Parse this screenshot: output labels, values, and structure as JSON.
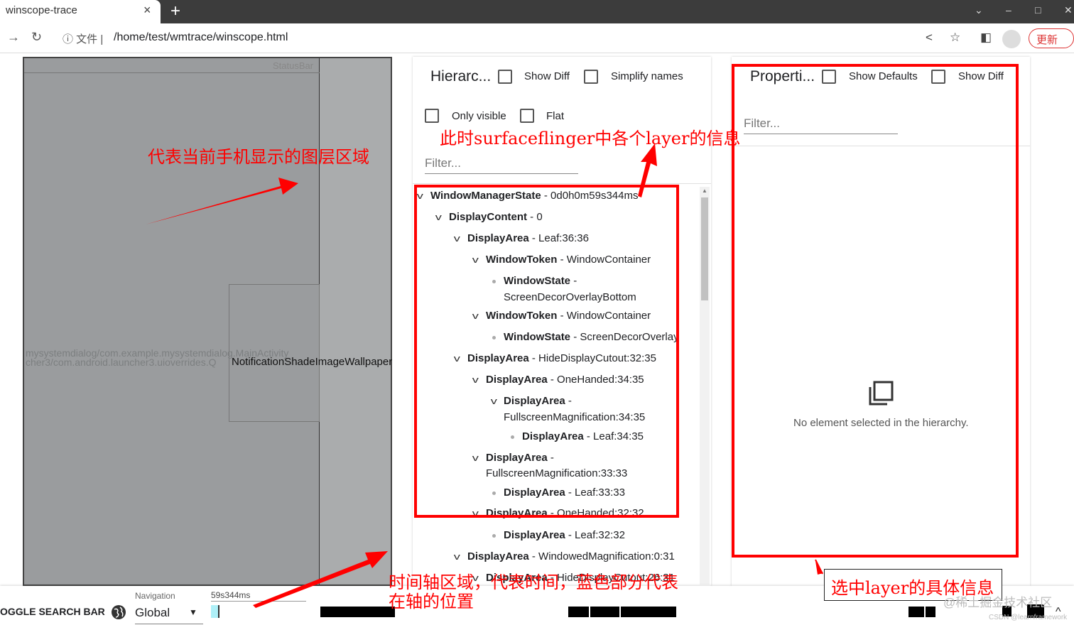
{
  "browser": {
    "tab_title": "winscope-trace",
    "tab_close": "×",
    "new_tab": "+",
    "url_info": "ⓘ 文件 |",
    "url": "/home/test/wmtrace/winscope.html",
    "update_label": "更新",
    "window_controls": [
      "⌄",
      "–",
      "□",
      "✕"
    ]
  },
  "screen": {
    "statusbar_label": "StatusBar",
    "layer_1": "mysystemdialog/com.example.mysystemdialog.MainActivity",
    "layer_2": "cher3/com.android.launcher3.uioverrides.Q",
    "notification_label": "NotificationShadeImageWallpaper"
  },
  "hierarchy": {
    "title": "Hierarc...",
    "show_diff": "Show Diff",
    "simplify_names": "Simplify names",
    "only_visible": "Only visible",
    "flat": "Flat",
    "filter_placeholder": "Filter...",
    "tree": [
      {
        "kind": "WindowManagerState",
        "name": " - 0d0h0m59s344ms"
      },
      {
        "kind": "DisplayContent",
        "name": " - 0"
      },
      {
        "kind": "DisplayArea",
        "name": " - Leaf:36:36"
      },
      {
        "kind": "WindowToken",
        "name": " - WindowContainer"
      },
      {
        "kind": "WindowState",
        "name": " -"
      },
      {
        "kind": "",
        "name": "ScreenDecorOverlayBottom"
      },
      {
        "kind": "WindowToken",
        "name": " - WindowContainer"
      },
      {
        "kind": "WindowState",
        "name": " - ScreenDecorOverlay"
      },
      {
        "kind": "DisplayArea",
        "name": " - HideDisplayCutout:32:35"
      },
      {
        "kind": "DisplayArea",
        "name": " - OneHanded:34:35"
      },
      {
        "kind": "DisplayArea",
        "name": " -"
      },
      {
        "kind": "",
        "name": "FullscreenMagnification:34:35"
      },
      {
        "kind": "DisplayArea",
        "name": " - Leaf:34:35"
      },
      {
        "kind": "DisplayArea",
        "name": " -"
      },
      {
        "kind": "",
        "name": "FullscreenMagnification:33:33"
      },
      {
        "kind": "DisplayArea",
        "name": " - Leaf:33:33"
      },
      {
        "kind": "DisplayArea",
        "name": " - OneHanded:32:32"
      },
      {
        "kind": "DisplayArea",
        "name": " - Leaf:32:32"
      },
      {
        "kind": "DisplayArea",
        "name": " - WindowedMagnification:0:31"
      },
      {
        "kind": "DisplayArea",
        "name": " - HideDisplayCutout:26:31"
      }
    ]
  },
  "properties": {
    "title": "Properti...",
    "show_defaults": "Show Defaults",
    "show_diff": "Show Diff",
    "filter_placeholder": "Filter...",
    "empty_message": "No element selected in the hierarchy."
  },
  "annotations": {
    "screen_note": "代表当前手机显示的图层区域",
    "hierarchy_note": "此时surfaceflinger中各个layer的信息",
    "timeline_note_line1": "时间轴区域，代表时间，蓝色部分代表",
    "timeline_note_line2": "在轴的位置",
    "properties_note": "选中layer的具体信息"
  },
  "timeline": {
    "toggle_label": "OGGLE SEARCH BAR",
    "navigation_label": "Navigation",
    "navigation_value": "Global",
    "time_label": "59s344ms"
  },
  "watermark": "@稀土掘金技术社区",
  "watermark_small": "CSDN @learnframework",
  "colors": {
    "annotation": "#ff0000",
    "cursor": "#aef0f8"
  }
}
